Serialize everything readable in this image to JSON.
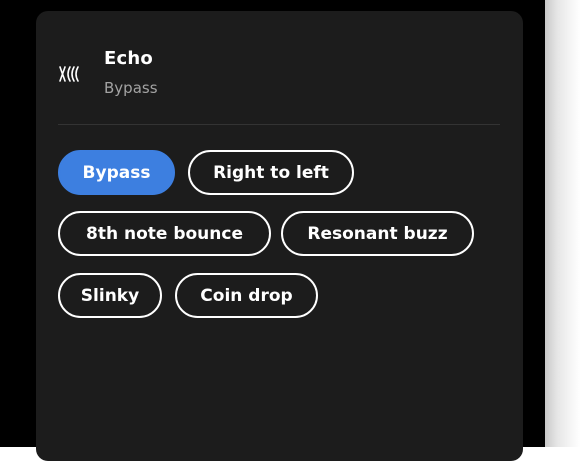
{
  "effect": {
    "icon": "echo-wave-icon",
    "title": "Echo",
    "current_preset": "Bypass"
  },
  "presets": [
    {
      "label": "Bypass",
      "selected": true
    },
    {
      "label": "Right to left",
      "selected": false
    },
    {
      "label": "8th note bounce",
      "selected": false
    },
    {
      "label": "Resonant buzz",
      "selected": false
    },
    {
      "label": "Slinky",
      "selected": false
    },
    {
      "label": "Coin drop",
      "selected": false
    }
  ],
  "colors": {
    "selected_chip": "#3d7fe0",
    "panel": "#1c1c1c",
    "background": "#000000"
  }
}
